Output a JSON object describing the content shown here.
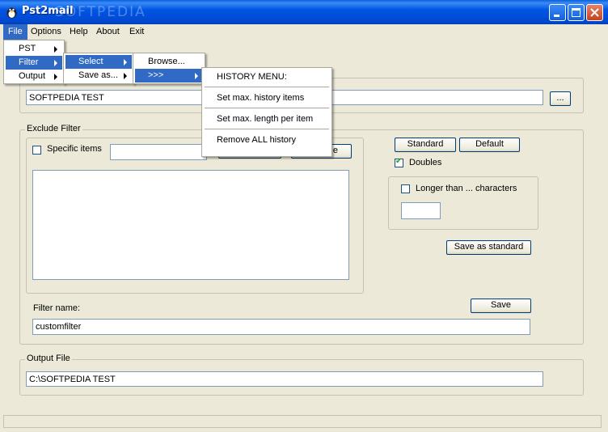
{
  "window": {
    "title": "Pst2mail",
    "watermark": "SOFTPEDIA"
  },
  "menubar": {
    "items": [
      "File",
      "Options",
      "Help",
      "About",
      "Exit"
    ]
  },
  "menus": {
    "file": [
      "PST",
      "Filter",
      "Output"
    ],
    "filter": [
      "Select",
      "Save as..."
    ],
    "select": [
      "Browse...",
      ">>>"
    ],
    "history": [
      "HISTORY MENU:",
      "Set max. history items",
      "Set max. length per item",
      "Remove ALL history"
    ]
  },
  "source": {
    "value": "SOFTPEDIA TEST",
    "browse_label": "..."
  },
  "exclude": {
    "title": "Exclude Filter",
    "specific_items_label": "Specific items",
    "specific_items_value": "",
    "remove_label_partial": "e",
    "standard_label": "Standard",
    "default_label": "Default",
    "doubles_label": "Doubles",
    "doubles_checked": true,
    "longer_than_label": "Longer than ... characters",
    "longer_than_checked": false,
    "longer_than_value": "",
    "save_as_standard_label": "Save as standard",
    "filter_name_label": "Filter name:",
    "filter_name_value": "customfilter",
    "save_label": "Save"
  },
  "output": {
    "title": "Output File",
    "value": "C:\\SOFTPEDIA TEST"
  }
}
